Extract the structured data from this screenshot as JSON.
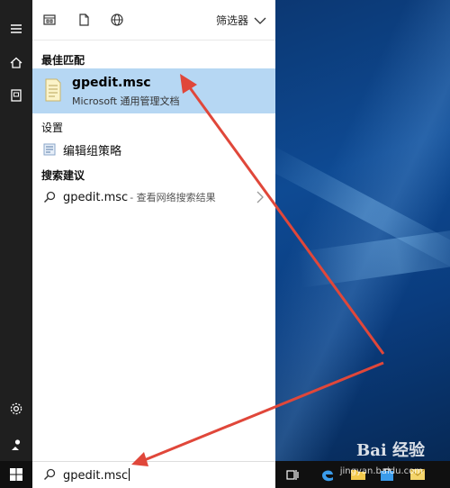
{
  "panel": {
    "filter_label": "筛选器",
    "best_match_header": "最佳匹配",
    "best_match": {
      "title": "gpedit.msc",
      "subtitle": "Microsoft 通用管理文档"
    },
    "settings_header": "设置",
    "settings_item": "编辑组策略",
    "search_suggest_header": "搜索建议",
    "suggest_item": {
      "query": "gpedit.msc",
      "hint": "- 查看网络搜索结果"
    }
  },
  "taskbar": {
    "search_value": "gpedit.msc"
  },
  "watermark": {
    "brand": "Bai 经验",
    "url": "jingyan.baidu.com"
  },
  "colors": {
    "accent_selected": "#b6d7f3",
    "annotation_arrow": "#e0473a",
    "rail": "#1f1f1f",
    "taskbar": "#101010"
  },
  "icons": [
    "menu-icon",
    "home-icon",
    "document-icon",
    "settings-icon",
    "user-icon",
    "windows-start-icon",
    "apps-filter-icon",
    "doc-filter-icon",
    "web-filter-icon",
    "chevron-down-icon",
    "msc-file-icon",
    "settings-item-icon",
    "search-icon",
    "chevron-right-icon",
    "task-view-icon",
    "edge-icon",
    "store-icon",
    "mail-icon"
  ]
}
